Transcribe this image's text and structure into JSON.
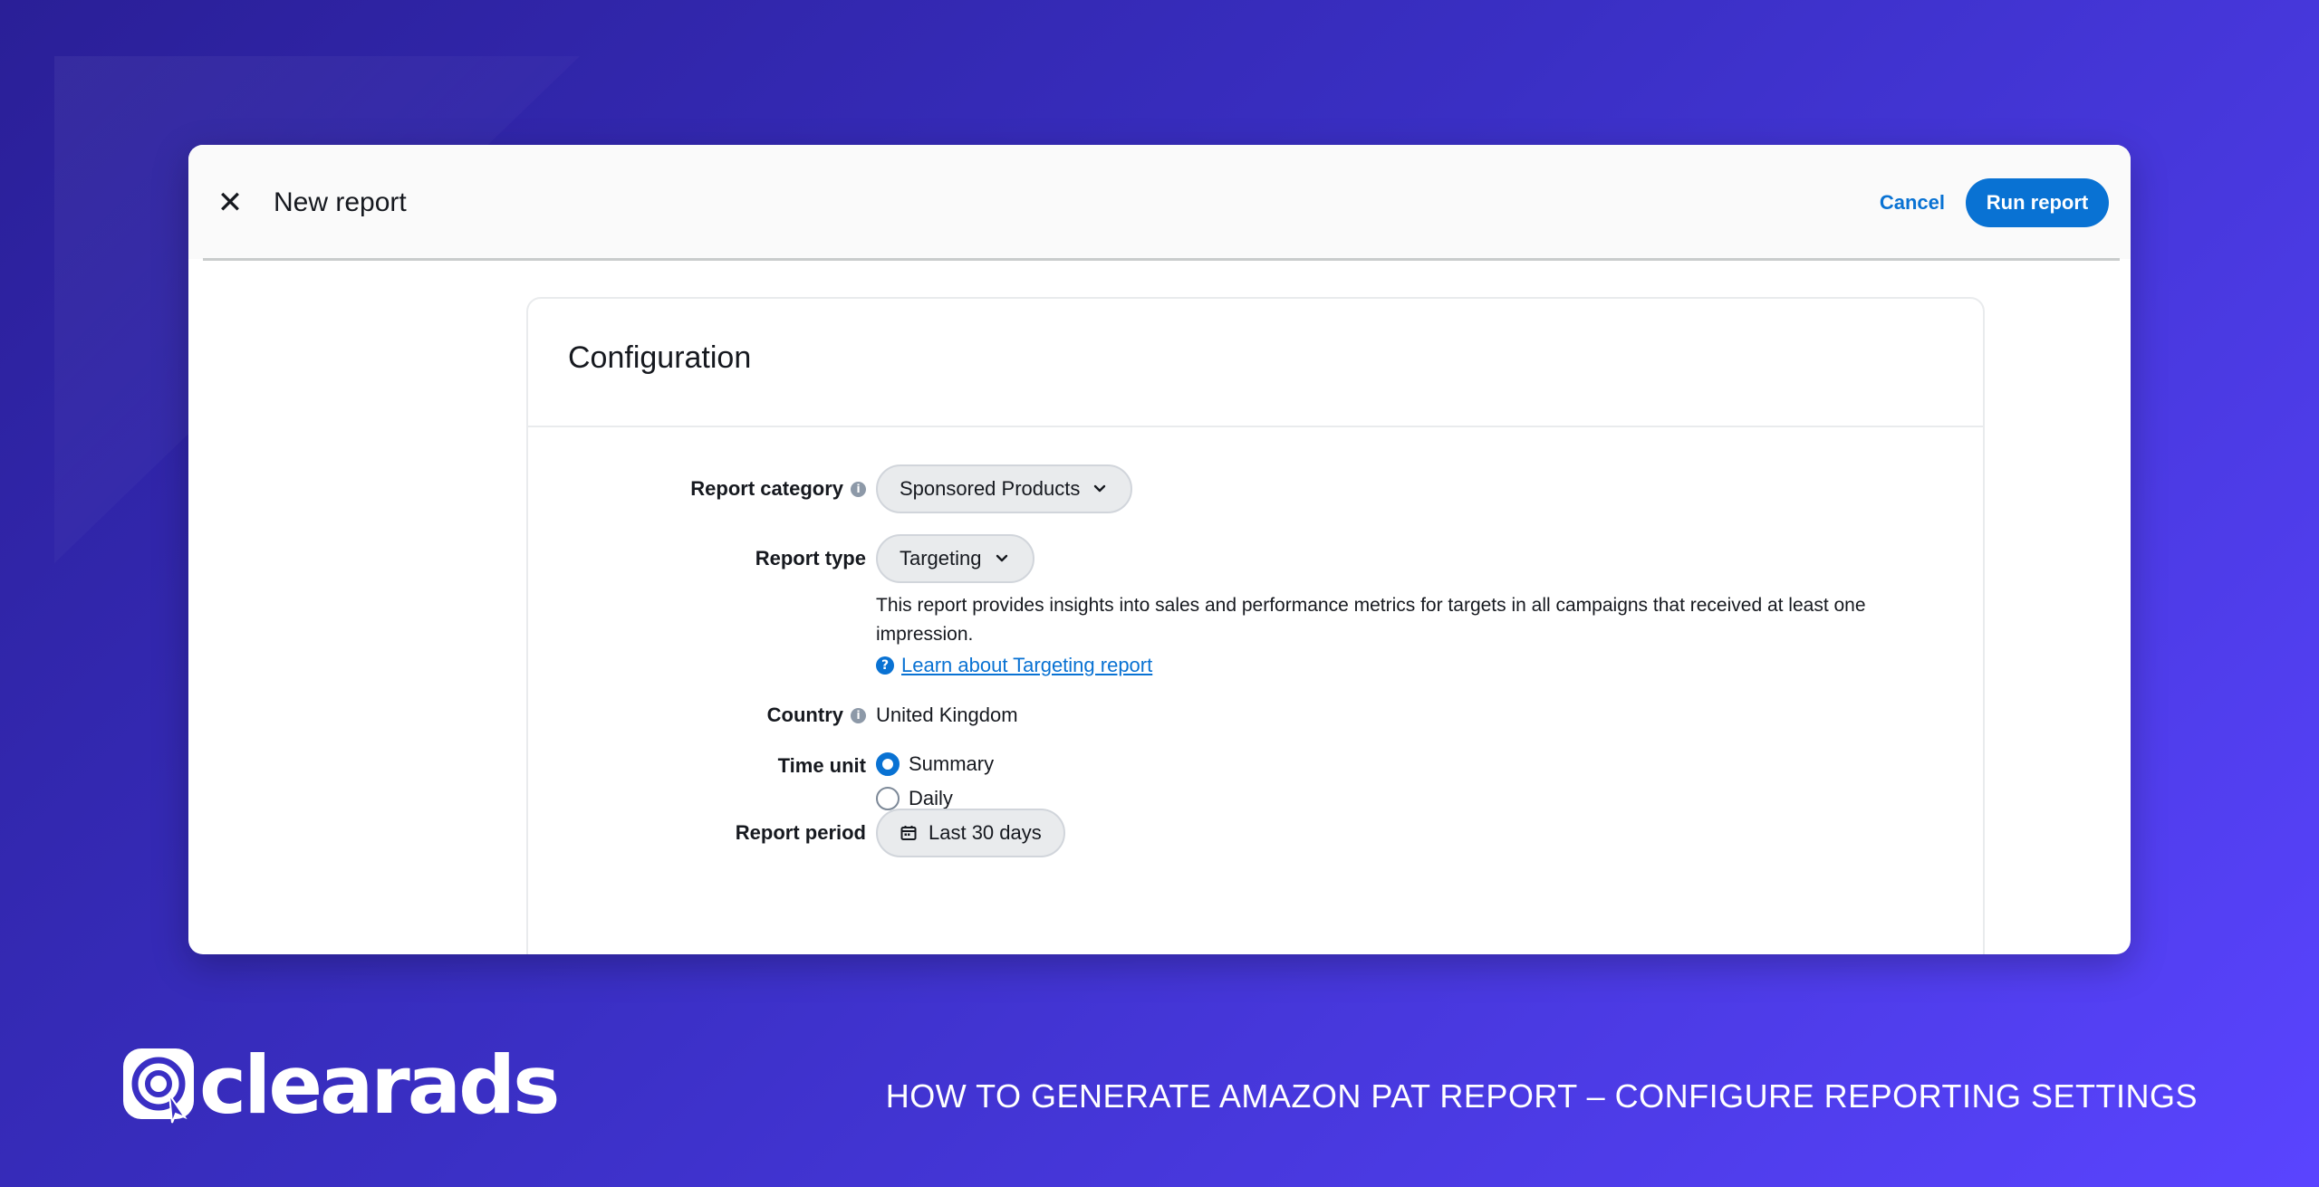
{
  "dialog": {
    "title": "New report",
    "cancel_label": "Cancel",
    "run_label": "Run report"
  },
  "configuration": {
    "heading": "Configuration",
    "report_category": {
      "label": "Report category",
      "value": "Sponsored Products"
    },
    "report_type": {
      "label": "Report type",
      "value": "Targeting",
      "description": "This report provides insights into sales and performance metrics for targets in all campaigns that received at least one impression.",
      "help_link": "Learn about Targeting report"
    },
    "country": {
      "label": "Country",
      "value": "United Kingdom"
    },
    "time_unit": {
      "label": "Time unit",
      "options": [
        {
          "label": "Summary",
          "selected": true
        },
        {
          "label": "Daily",
          "selected": false
        }
      ]
    },
    "report_period": {
      "label": "Report period",
      "value": "Last 30 days"
    }
  },
  "branding": {
    "logo_text": "clearads",
    "caption": "HOW TO GENERATE AMAZON PAT REPORT – CONFIGURE REPORTING SETTINGS"
  },
  "colors": {
    "accent": "#0972d3",
    "background_start": "#2a1f97",
    "background_end": "#5a44ff"
  }
}
